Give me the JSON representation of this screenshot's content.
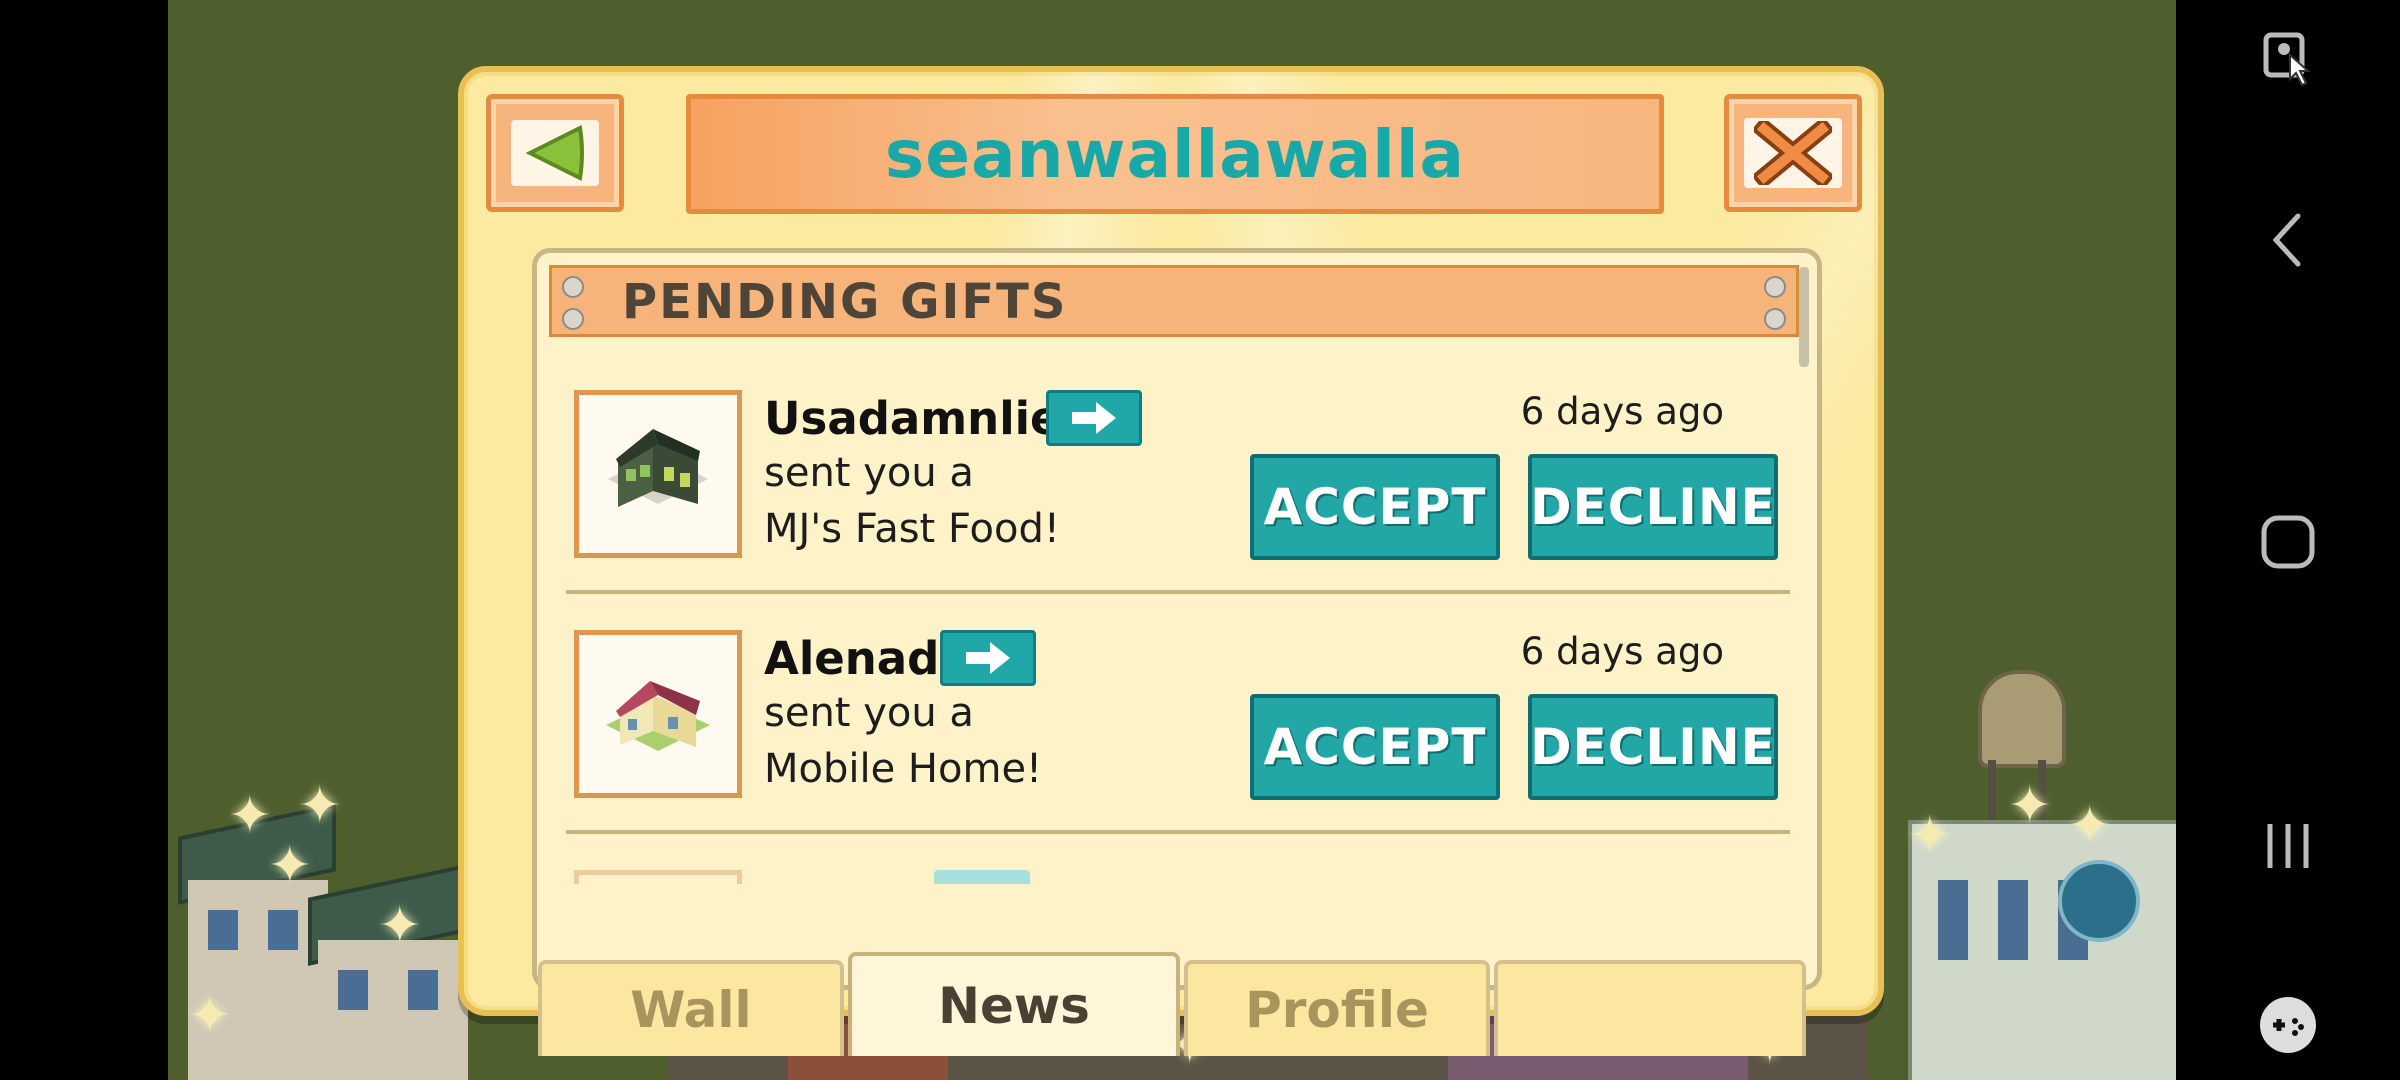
{
  "dialog": {
    "title": "seanwallawalla",
    "section_title": "PENDING GIFTS",
    "gifts": [
      {
        "sender": "Usadamnlie",
        "line1": "sent you a",
        "line2": "MJ's Fast Food!",
        "time": "6 days ago",
        "accept_label": "ACCEPT",
        "decline_label": "DECLINE"
      },
      {
        "sender": "Alenad",
        "line1": "sent you a",
        "line2": "Mobile Home!",
        "time": "6 days ago",
        "accept_label": "ACCEPT",
        "decline_label": "DECLINE"
      }
    ],
    "tabs": [
      {
        "label": "Wall",
        "active": false
      },
      {
        "label": "News",
        "active": true
      },
      {
        "label": "Profile",
        "active": false
      },
      {
        "label": "",
        "active": false
      }
    ]
  },
  "colors": {
    "accent_teal": "#22a6a6",
    "orange": "#f6a260",
    "panel_bg": "#fdf2c8"
  },
  "icons": {
    "back": "back-arrow-icon",
    "close": "close-x-icon",
    "send_arrow": "arrow-right-icon"
  }
}
